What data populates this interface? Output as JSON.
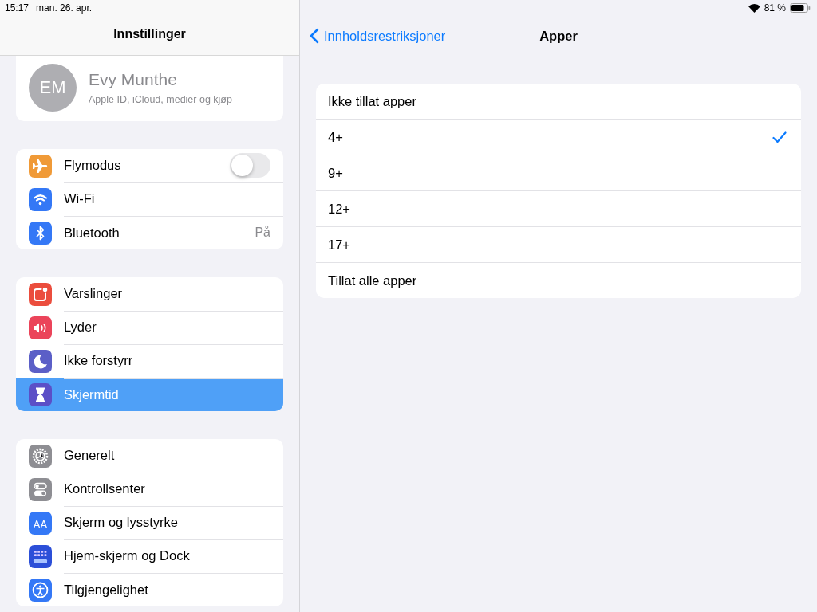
{
  "status_bar": {
    "time": "15:17",
    "date": "man. 26. apr.",
    "battery": "81 %"
  },
  "sidebar": {
    "title": "Innstillinger",
    "profile": {
      "initials": "EM",
      "name": "Evy Munthe",
      "subtitle": "Apple ID, iCloud, medier og kjøp"
    },
    "groups": [
      [
        {
          "label": "Flymodus",
          "color": "#f09a37",
          "kind": "toggle",
          "on": false,
          "selected": false
        },
        {
          "label": "Wi-Fi",
          "color": "#3478f6",
          "kind": "plain",
          "selected": false
        },
        {
          "label": "Bluetooth",
          "color": "#3478f6",
          "kind": "value",
          "value": "På",
          "selected": false
        }
      ],
      [
        {
          "label": "Varslinger",
          "color": "#eb4d3d",
          "kind": "plain",
          "selected": false
        },
        {
          "label": "Lyder",
          "color": "#eb445a",
          "kind": "plain",
          "selected": false
        },
        {
          "label": "Ikke forstyrr",
          "color": "#5b5fc7",
          "kind": "plain",
          "selected": false
        },
        {
          "label": "Skjermtid",
          "color": "#5b4fc7",
          "kind": "plain",
          "selected": true
        }
      ],
      [
        {
          "label": "Generelt",
          "color": "#8e8e93",
          "kind": "plain",
          "selected": false
        },
        {
          "label": "Kontrollsenter",
          "color": "#8e8e93",
          "kind": "plain",
          "selected": false
        },
        {
          "label": "Skjerm og lysstyrke",
          "icon_text": "AA",
          "color": "#3478f6",
          "kind": "plain",
          "selected": false
        },
        {
          "label": "Hjem-skjerm og Dock",
          "color": "#2c4fd8",
          "kind": "plain",
          "selected": false
        },
        {
          "label": "Tilgjengelighet",
          "color": "#3478f6",
          "kind": "plain",
          "selected": false
        }
      ]
    ]
  },
  "detail": {
    "back": "Innholdsrestriksjoner",
    "title": "Apper",
    "options": [
      {
        "label": "Ikke tillat apper",
        "selected": false
      },
      {
        "label": "4+",
        "selected": true
      },
      {
        "label": "9+",
        "selected": false
      },
      {
        "label": "12+",
        "selected": false
      },
      {
        "label": "17+",
        "selected": false
      },
      {
        "label": "Tillat alle apper",
        "selected": false
      }
    ]
  }
}
